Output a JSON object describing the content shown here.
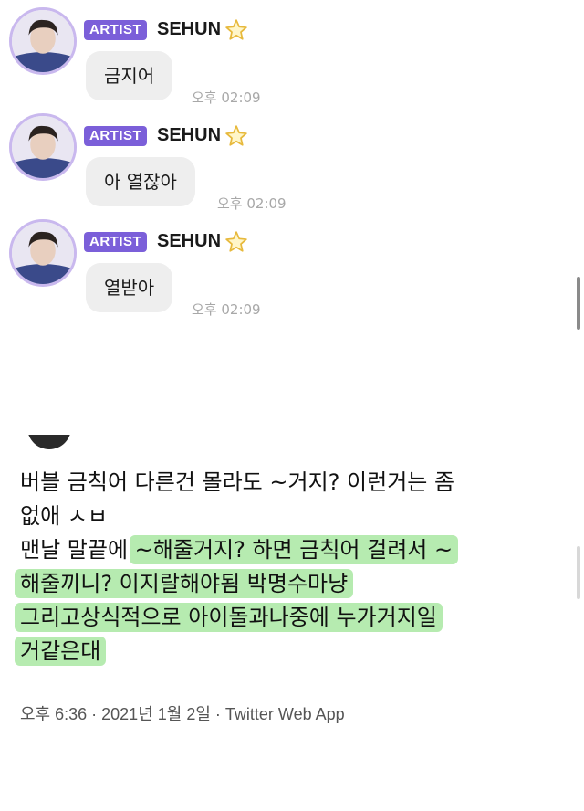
{
  "chat": {
    "messages": [
      {
        "badge": "ARTIST",
        "name": "SEHUN",
        "text": "금지어",
        "time": "오후 02:09"
      },
      {
        "badge": "ARTIST",
        "name": "SEHUN",
        "text": "아 열잖아",
        "time": "오후 02:09"
      },
      {
        "badge": "ARTIST",
        "name": "SEHUN",
        "text": "열받아",
        "time": "오후 02:09"
      }
    ],
    "icons": {
      "avatar": "profile-photo-icon",
      "star": "star-icon"
    },
    "colors": {
      "badge": "#7b5fd9",
      "bubble": "#eeeeee",
      "avatar_ring": "#c9b8ee"
    }
  },
  "tweet": {
    "lines": [
      "버블 금칙어 다른건 몰라도 ~거지? 이런거는 좀",
      "없애 ㅅㅂ"
    ],
    "line3_plain": "맨날 말끝에 ",
    "line3_highlight": "~해줄거지? 하면 금칙어 걸려서 ~",
    "highlighted_lines": [
      "해줄끼니? 이지랄해야됨 박명수마냥",
      "그리고상식적으로 아이돌과나중에 누가거지일",
      "거같은대"
    ],
    "meta": "오후 6:36 · 2021년 1월 2일 · Twitter Web App",
    "colors": {
      "highlight": "#b6ebb0"
    }
  }
}
